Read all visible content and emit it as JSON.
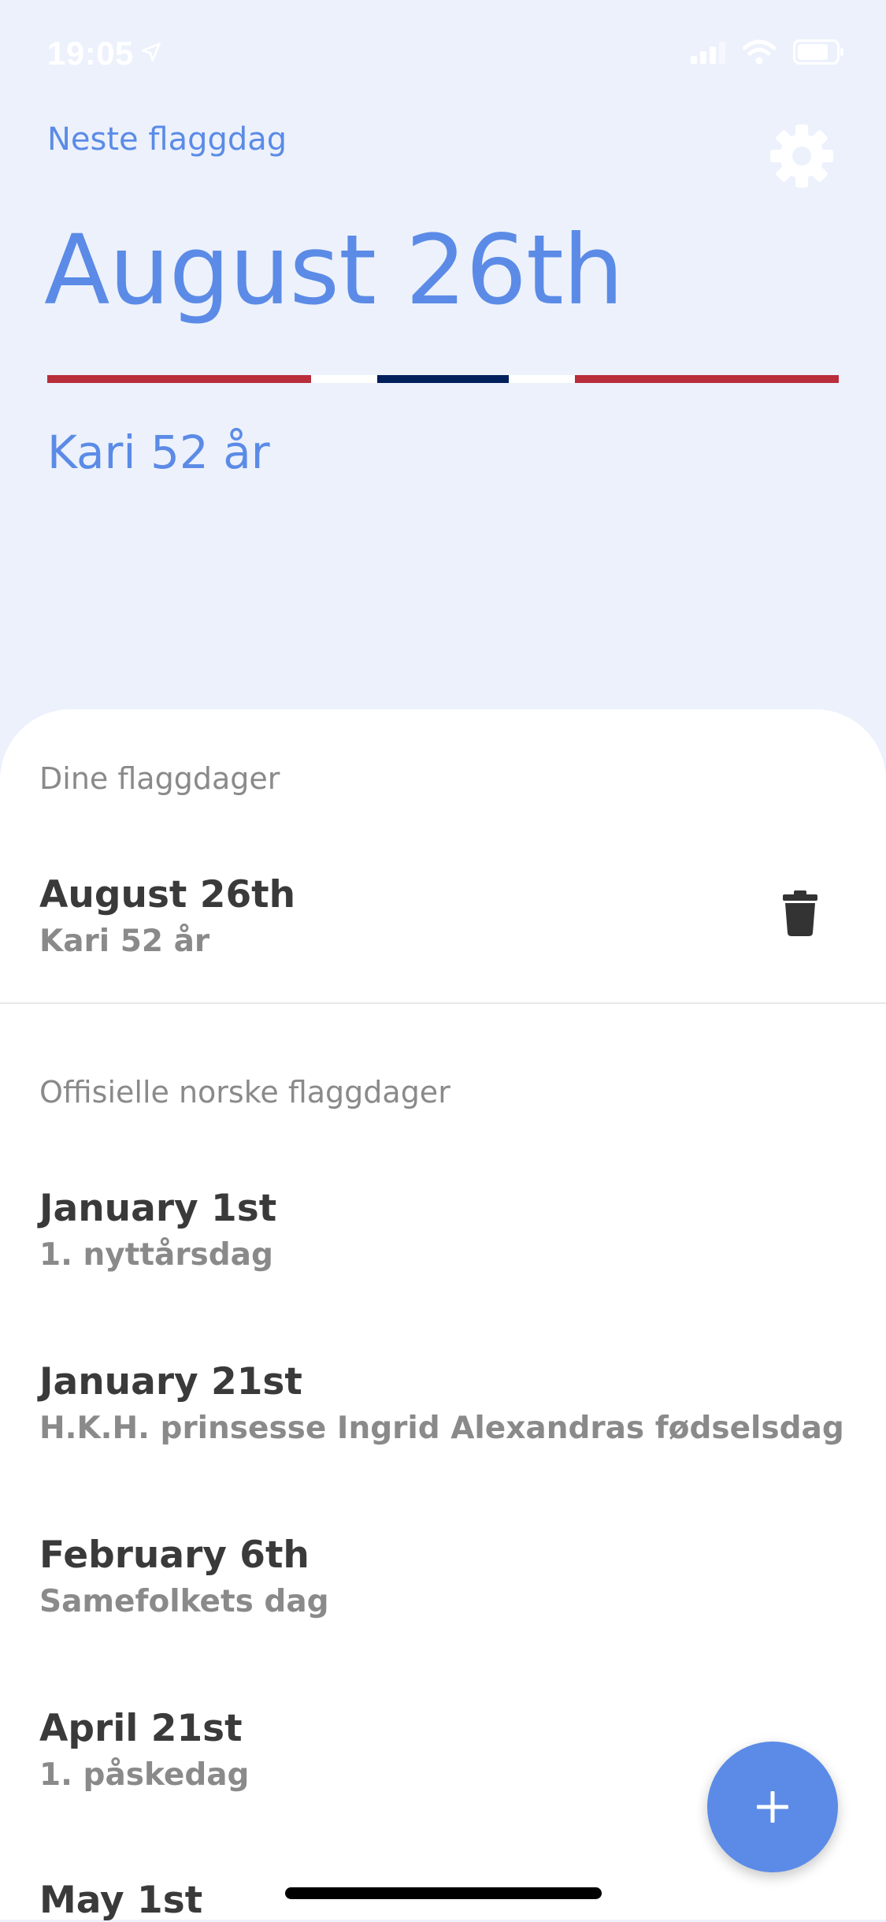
{
  "status_bar": {
    "time": "19:05",
    "icons": [
      "location-arrow-icon",
      "cellular-signal-icon",
      "wifi-icon",
      "battery-icon"
    ]
  },
  "header": {
    "label": "Neste flaggdag",
    "date": "August 26th",
    "subtitle": "Kari 52 år",
    "settings_icon": "gear-icon",
    "flag_colors": {
      "red": "#BA2D3B",
      "white": "#FFFFFF",
      "blue": "#00205B"
    }
  },
  "colors": {
    "accent": "#5B8BE6",
    "background": "#ECF1FC",
    "sheet": "#FFFFFF"
  },
  "my_flag_days": {
    "header": "Dine flaggdager",
    "items": [
      {
        "date": "August 26th",
        "name": "Kari 52 år",
        "action_icon": "trash-icon"
      }
    ]
  },
  "official_flag_days": {
    "header": "Offisielle norske flaggdager",
    "items": [
      {
        "date": "January 1st",
        "name": "1. nyttårsdag"
      },
      {
        "date": "January 21st",
        "name": "H.K.H. prinsesse Ingrid Alexandras fødselsdag"
      },
      {
        "date": "February 6th",
        "name": "Samefolkets dag"
      },
      {
        "date": "April 21st",
        "name": "1. påskedag"
      },
      {
        "date": "May 1st",
        "name": ""
      }
    ]
  },
  "fab": {
    "icon": "plus-icon"
  }
}
